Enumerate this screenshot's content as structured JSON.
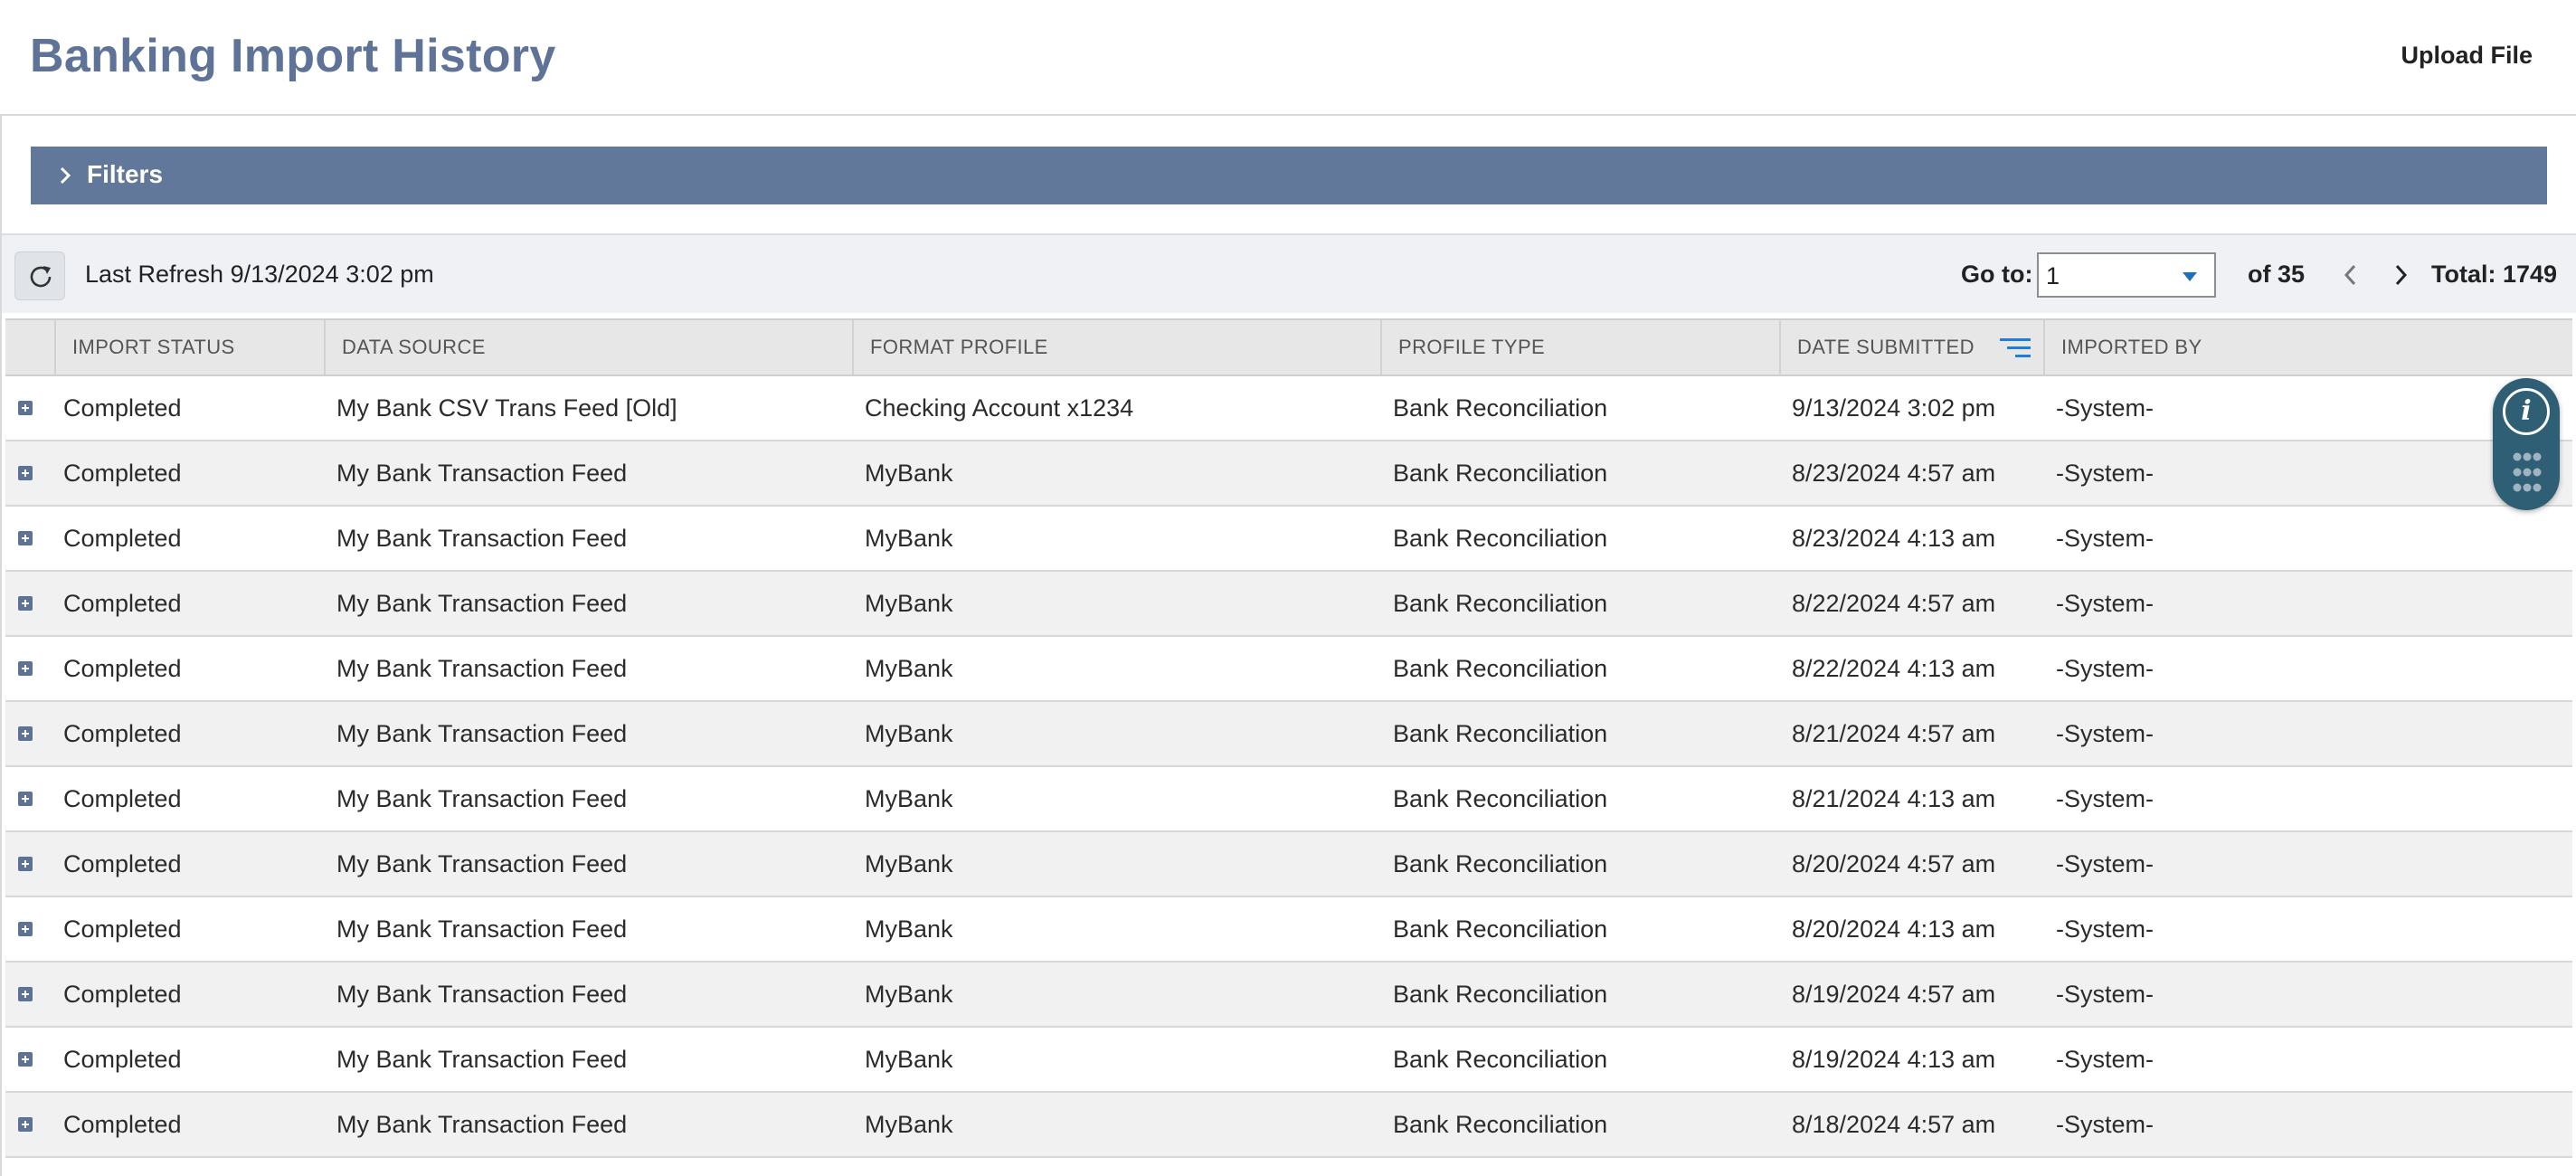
{
  "header": {
    "title": "Banking Import History",
    "upload_label": "Upload File"
  },
  "filters": {
    "label": "Filters"
  },
  "toolbar": {
    "last_refresh": "Last Refresh 9/13/2024 3:02 pm",
    "goto_label": "Go to:",
    "goto_value": "1",
    "of_pages": "of 35",
    "total": "Total: 1749"
  },
  "table": {
    "columns": [
      "IMPORT STATUS",
      "DATA SOURCE",
      "FORMAT PROFILE",
      "PROFILE TYPE",
      "DATE SUBMITTED",
      "IMPORTED BY"
    ],
    "rows": [
      [
        "Completed",
        "My Bank CSV Trans Feed [Old]",
        "Checking Account x1234",
        "Bank Reconciliation",
        "9/13/2024 3:02 pm",
        "-System-"
      ],
      [
        "Completed",
        "My Bank Transaction Feed",
        "MyBank",
        "Bank Reconciliation",
        "8/23/2024 4:57 am",
        "-System-"
      ],
      [
        "Completed",
        "My Bank Transaction Feed",
        "MyBank",
        "Bank Reconciliation",
        "8/23/2024 4:13 am",
        "-System-"
      ],
      [
        "Completed",
        "My Bank Transaction Feed",
        "MyBank",
        "Bank Reconciliation",
        "8/22/2024 4:57 am",
        "-System-"
      ],
      [
        "Completed",
        "My Bank Transaction Feed",
        "MyBank",
        "Bank Reconciliation",
        "8/22/2024 4:13 am",
        "-System-"
      ],
      [
        "Completed",
        "My Bank Transaction Feed",
        "MyBank",
        "Bank Reconciliation",
        "8/21/2024 4:57 am",
        "-System-"
      ],
      [
        "Completed",
        "My Bank Transaction Feed",
        "MyBank",
        "Bank Reconciliation",
        "8/21/2024 4:13 am",
        "-System-"
      ],
      [
        "Completed",
        "My Bank Transaction Feed",
        "MyBank",
        "Bank Reconciliation",
        "8/20/2024 4:57 am",
        "-System-"
      ],
      [
        "Completed",
        "My Bank Transaction Feed",
        "MyBank",
        "Bank Reconciliation",
        "8/20/2024 4:13 am",
        "-System-"
      ],
      [
        "Completed",
        "My Bank Transaction Feed",
        "MyBank",
        "Bank Reconciliation",
        "8/19/2024 4:57 am",
        "-System-"
      ],
      [
        "Completed",
        "My Bank Transaction Feed",
        "MyBank",
        "Bank Reconciliation",
        "8/19/2024 4:13 am",
        "-System-"
      ],
      [
        "Completed",
        "My Bank Transaction Feed",
        "MyBank",
        "Bank Reconciliation",
        "8/18/2024 4:57 am",
        "-System-"
      ]
    ]
  },
  "icons": {
    "refresh": "refresh-icon",
    "filters_chevron": "chevron-right-icon",
    "goto_caret": "caret-down-icon",
    "prev": "chevron-left-icon",
    "next": "chevron-right-icon",
    "sort": "sort-descending-icon",
    "expand": "plus-square-icon",
    "info": "info-icon",
    "apps": "grid-dots-icon"
  },
  "colors": {
    "title": "#5e7397",
    "filters_bar": "#61789b",
    "sort_icon": "#1f7fd8",
    "widget": "#2f5f74"
  }
}
